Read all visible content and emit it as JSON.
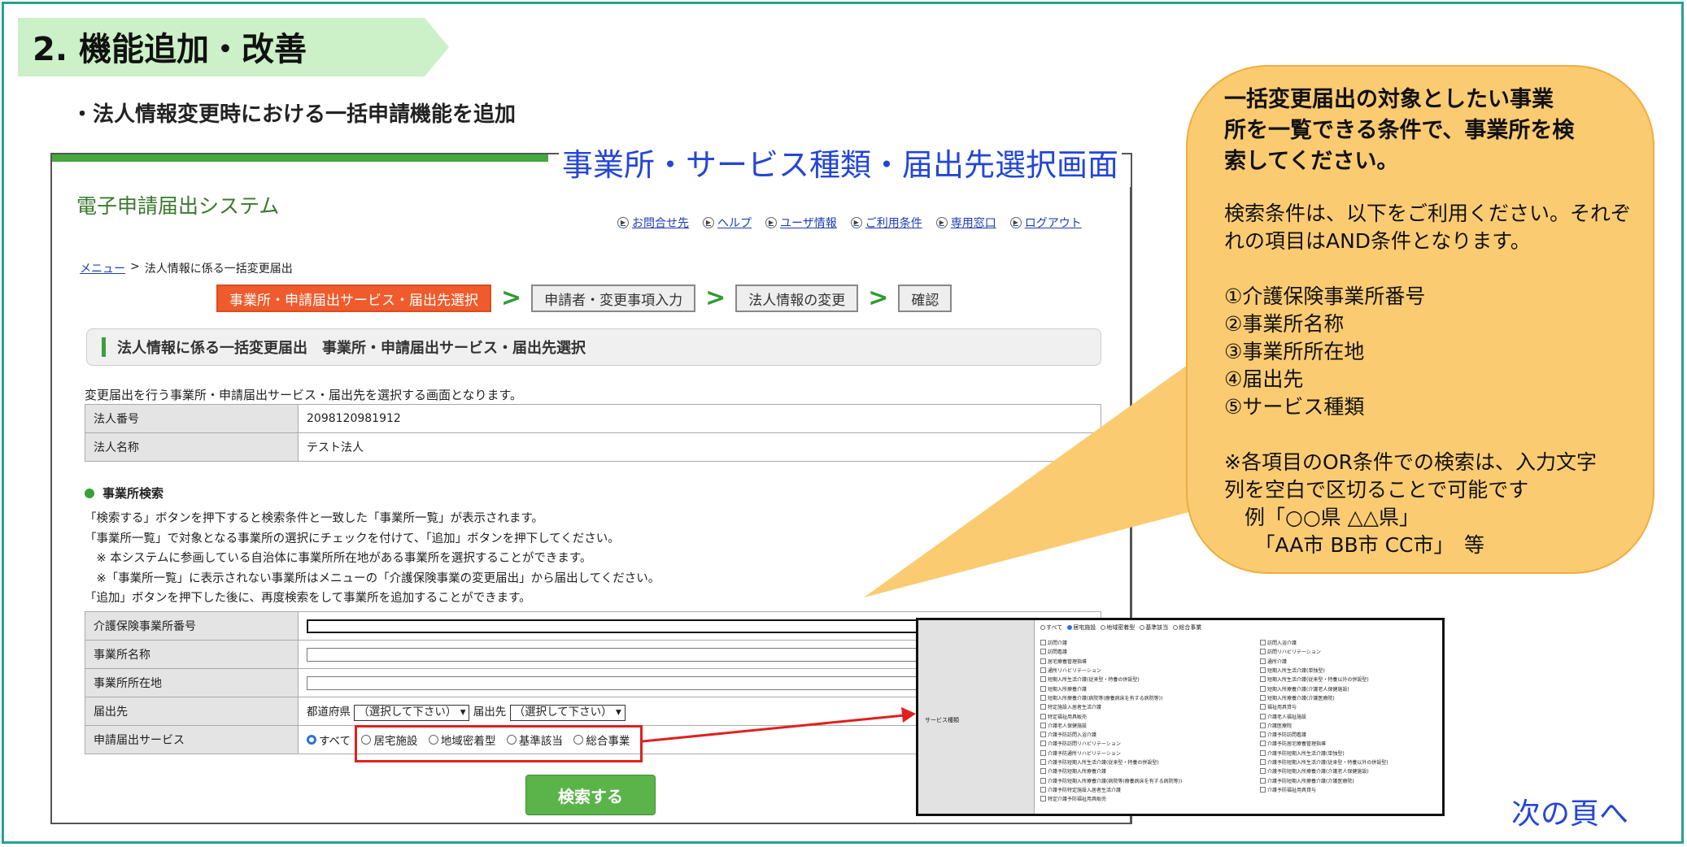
{
  "section": {
    "title": "2. 機能追加・改善"
  },
  "subtitle": "・法人情報変更時における一括申請機能を追加",
  "screen_caption": "事業所・サービス種類・届出先選択画面",
  "app": {
    "title": "電子申請届出システム",
    "top_links": [
      "お問合せ先",
      "ヘルプ",
      "ユーザ情報",
      "ご利用条件",
      "専用窓口",
      "ログアウト"
    ],
    "breadcrumb": {
      "menu": "メニュー",
      "sep": ">",
      "current": "法人情報に係る一括変更届出"
    },
    "steps": [
      "事業所・申請届出サービス・届出先選択",
      "申請者・変更事項入力",
      "法人情報の変更",
      "確認"
    ],
    "page_heading": "法人情報に係る一括変更届出　事業所・申請届出サービス・届出先選択",
    "intro": "変更届出を行う事業所・申請届出サービス・届出先を選択する画面となります。",
    "corp_table": [
      {
        "label": "法人番号",
        "value": "2098120981912"
      },
      {
        "label": "法人名称",
        "value": "テスト法人"
      }
    ],
    "search_heading": "事業所検索",
    "instructions": [
      "「検索する」ボタンを押下すると検索条件と一致した「事業所一覧」が表示されます。",
      "「事業所一覧」で対象となる事業所の選択にチェックを付けて、「追加」ボタンを押下してください。",
      "　※ 本システムに参画している自治体に事業所所在地がある事業所を選択することができます。",
      "　※「事業所一覧」に表示されない事業所はメニューの「介護保険事業の変更届出」から届出してください。",
      "「追加」ボタンを押下した後に、再度検索をして事業所を追加することができます。"
    ],
    "search_form": {
      "labels": [
        "介護保険事業所番号",
        "事業所名称",
        "事業所所在地",
        "届出先",
        "申請届出サービス"
      ],
      "pref_label": "都道府県",
      "pref_select": "（選択して下さい）",
      "dest_label": "届出先",
      "dest_select": "（選択して下さい）",
      "service_options": [
        "すべて",
        "居宅施設",
        "地域密着型",
        "基準該当",
        "総合事業"
      ],
      "service_selected": "すべて"
    },
    "search_button": "検索する"
  },
  "inset": {
    "row_label": "サービス種類",
    "radios": [
      "すべて",
      "居宅施設",
      "地域密着型",
      "基準該当",
      "総合事業"
    ],
    "radio_selected": "居宅施設",
    "left_items": [
      "訪問介護",
      "訪問看護",
      "居宅療養管理指導",
      "通所リハビリテーション",
      "短期入所生活介護(従来型・特養の併設型)",
      "短期入所療養介護",
      "短期入所療養介護(病院等(療養病床を有する病院等))",
      "特定施設入居者生活介護",
      "特定福祉用具販売",
      "介護老人保健施設",
      "介護予防訪問入浴介護",
      "介護予防訪問リハビリテーション",
      "介護予防通所リハビリテーション",
      "介護予防短期入所生活介護(従来型・特養の併設型)",
      "介護予防短期入所療養介護",
      "介護予防短期入所療養介護(病院等(療養病床を有する病院等))",
      "介護予防特定施設入居者生活介護",
      "特定介護予防福祉用具販売"
    ],
    "right_items": [
      "訪問入浴介護",
      "訪問リハビリテーション",
      "通所介護",
      "短期入所生活介護(単独型)",
      "短期入所生活介護(従来型・特養以外の併設型)",
      "短期入所療養介護(介護老人保健施設)",
      "短期入所療養介護(介護医療院)",
      "福祉用具貸与",
      "介護老人福祉施設",
      "介護医療院",
      "介護予防訪問看護",
      "介護予防居宅療養管理指導",
      "介護予防短期入所生活介護(単独型)",
      "介護予防短期入所生活介護(従来型・特養以外の併設型)",
      "介護予防短期入所療養介護(介護老人保健施設)",
      "介護予防短期入所療養介護(介護医療院)",
      "介護予防福祉用具貸与"
    ]
  },
  "bubble": {
    "heading": [
      "一括変更届出の対象としたい事業",
      "所を一覧できる条件で、事業所を検",
      "索してください。"
    ],
    "cond_intro": [
      "検索条件は、以下をご利用ください。それぞ",
      "れの項目はAND条件となります。"
    ],
    "conditions": [
      "①介護保険事業所番号",
      "②事業所名称",
      "③事業所所在地",
      "④届出先",
      "⑤サービス種類"
    ],
    "note": [
      "※各項目のOR条件での検索は、入力文字",
      "列を空白で区切ることで可能です",
      "　例「○○県 △△県」",
      "　　「AA市 BB市 CC市」　等"
    ]
  },
  "next_page": "次の頁へ",
  "colors": {
    "frame": "#2aa18f",
    "tab": "#ccf0c7",
    "bubble": "#fbcb72",
    "active_step": "#ef5b2c",
    "button": "#5bb44a",
    "highlight": "#e02020",
    "caption": "#2446d6"
  }
}
